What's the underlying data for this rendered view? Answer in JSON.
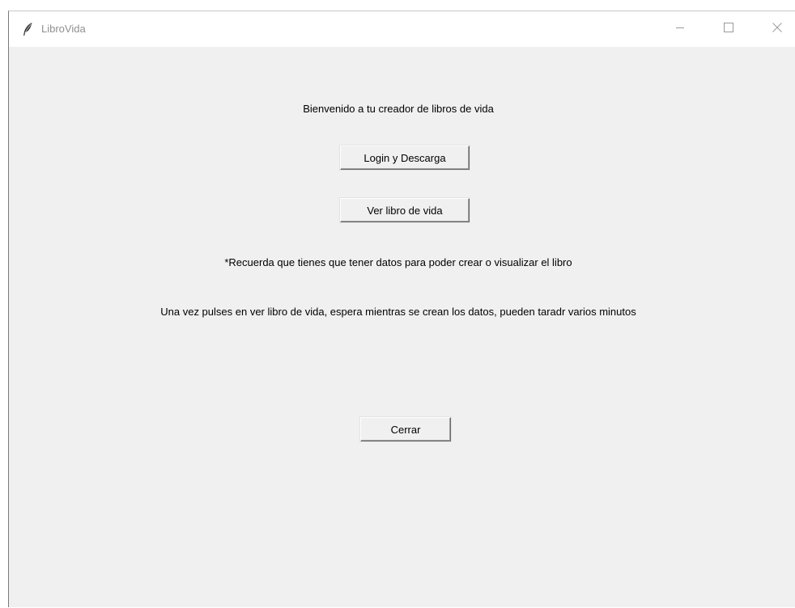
{
  "window": {
    "title": "LibroVida",
    "icon": "feather-icon",
    "controls": {
      "minimize_icon": "minimize-icon",
      "maximize_icon": "maximize-icon",
      "close_icon": "close-icon"
    }
  },
  "main": {
    "welcome_text": "Bienvenido a tu creador de libros de vida",
    "login_button": "Login y Descarga",
    "view_button": "Ver libro de vida",
    "reminder_text": "*Recuerda que tienes que tener datos para poder crear o visualizar el libro",
    "wait_text": "Una vez pulses en ver libro de vida, espera mientras se crean los datos, pueden taradr varios minutos",
    "close_button": "Cerrar"
  },
  "colors": {
    "window_background": "#f0f0f0",
    "titlebar_background": "#ffffff",
    "title_text": "#909090"
  }
}
